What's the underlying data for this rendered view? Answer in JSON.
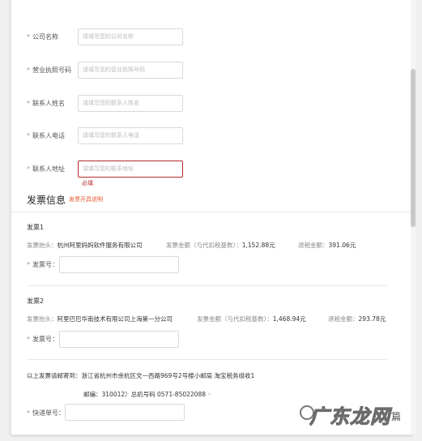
{
  "company_form": {
    "required_mark": "*",
    "fields": [
      {
        "label": "公司名称",
        "placeholder": "请填写您的公司名称"
      },
      {
        "label": "营业执照号码",
        "placeholder": "请填写您的营业执照号码"
      },
      {
        "label": "联系人姓名",
        "placeholder": "请填写您的联系人姓名"
      },
      {
        "label": "联系人电话",
        "placeholder": "请填写您的联系人电话"
      },
      {
        "label": "联系人地址",
        "placeholder": "请填写您的联系地址",
        "error": "必填"
      }
    ]
  },
  "invoice_section": {
    "title": "发票信息",
    "help_link": "发票开具说明",
    "invoices": [
      {
        "title": "发票1",
        "header_label": "发票抬头：",
        "header_value": "杭州阿里妈妈软件服务有限公司",
        "amount_label": "发票金额（与代扣税基数）：",
        "amount_value": "1,152.88元",
        "refund_label": "退税金额：",
        "refund_value": "391.06元",
        "number_label": "发票号："
      },
      {
        "title": "发票2",
        "header_label": "发票抬头：",
        "header_value": "阿里巴巴华南技术有限公司上海第一分公司",
        "amount_label": "发票金额（与代扣税基数）：",
        "amount_value": "1,468.94元",
        "refund_label": "退税金额：",
        "refund_value": "293.78元",
        "number_label": "发票号："
      }
    ],
    "mail_line1": "以上发票请邮寄到：浙江省杭州市余杭区文一西路969号2号楼小邮局 淘宝税务组收1",
    "mail_line2": "邮编：310012）总机号码 0571-85022088 ◦",
    "tracking_label": "快递单号："
  },
  "watermark": {
    "text": "广东龙网",
    "suffix": "篇"
  }
}
